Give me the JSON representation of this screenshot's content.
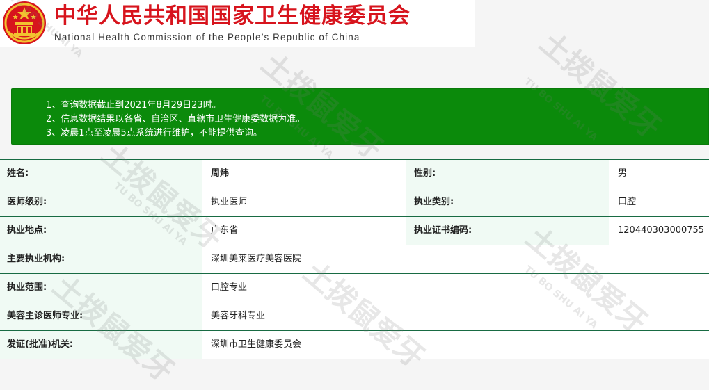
{
  "header": {
    "title_cn": "中华人民共和国国家卫生健康委员会",
    "title_en": "National Health Commission of the People’s Republic of China"
  },
  "notice": {
    "lines": [
      "1、查询数据截止到2021年8月29日23时。",
      "2、信息数据结果以各省、自治区、直辖市卫生健康委数据为准。",
      "3、凌晨1点至凌晨5点系统进行维护，不能提供查询。"
    ]
  },
  "record": {
    "name_label": "姓名:",
    "name_value": "周炜",
    "gender_label": "性别:",
    "gender_value": "男",
    "level_label": "医师级别:",
    "level_value": "执业医师",
    "category_label": "执业类别:",
    "category_value": "口腔",
    "location_label": "执业地点:",
    "location_value": "广东省",
    "cert_label": "执业证书编码:",
    "cert_value": "120440303000755",
    "institution_label": "主要执业机构:",
    "institution_value": "深圳美莱医疗美容医院",
    "scope_label": "执业范围:",
    "scope_value": "口腔专业",
    "cosmetic_label": "美容主诊医师专业:",
    "cosmetic_value": "美容牙科专业",
    "issuer_label": "发证(批准)机关:",
    "issuer_value": "深圳市卫生健康委员会"
  },
  "watermark": {
    "cn": "土拨鼠爱牙",
    "en": "TU BO SHU AI YA"
  },
  "colors": {
    "title_red": "#d7141d",
    "notice_green": "#0b8a0b",
    "row_border": "#186b43",
    "label_bg": "#f0faf4"
  }
}
